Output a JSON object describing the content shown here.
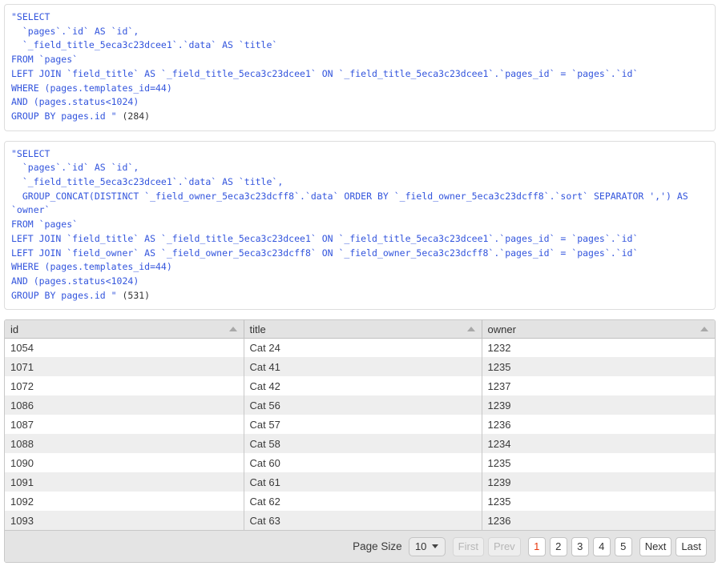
{
  "sql_blocks": [
    {
      "name": "query-one",
      "lines": [
        "\"SELECT",
        "  `pages`.`id` AS `id`,",
        "  `_field_title_5eca3c23dcee1`.`data` AS `title`",
        "FROM `pages`",
        "LEFT JOIN `field_title` AS `_field_title_5eca3c23dcee1` ON `_field_title_5eca3c23dcee1`.`pages_id` = `pages`.`id`",
        "WHERE (pages.templates_id=44)",
        "AND (pages.status<1024)",
        "GROUP BY pages.id \" "
      ],
      "count": "(284)"
    },
    {
      "name": "query-two",
      "lines": [
        "\"SELECT",
        "  `pages`.`id` AS `id`,",
        "  `_field_title_5eca3c23dcee1`.`data` AS `title`,",
        "  GROUP_CONCAT(DISTINCT `_field_owner_5eca3c23dcff8`.`data` ORDER BY `_field_owner_5eca3c23dcff8`.`sort` SEPARATOR ',') AS",
        "`owner`",
        "FROM `pages`",
        "LEFT JOIN `field_title` AS `_field_title_5eca3c23dcee1` ON `_field_title_5eca3c23dcee1`.`pages_id` = `pages`.`id`",
        "LEFT JOIN `field_owner` AS `_field_owner_5eca3c23dcff8` ON `_field_owner_5eca3c23dcff8`.`pages_id` = `pages`.`id`",
        "WHERE (pages.templates_id=44)",
        "AND (pages.status<1024)",
        "GROUP BY pages.id \" "
      ],
      "count": "(531)"
    }
  ],
  "grid": {
    "columns": [
      {
        "key": "id",
        "label": "id",
        "sort": "asc"
      },
      {
        "key": "title",
        "label": "title",
        "sort": "asc"
      },
      {
        "key": "owner",
        "label": "owner",
        "sort": "asc"
      }
    ],
    "rows": [
      {
        "id": "1054",
        "title": "Cat 24",
        "owner": "1232"
      },
      {
        "id": "1071",
        "title": "Cat 41",
        "owner": "1235"
      },
      {
        "id": "1072",
        "title": "Cat 42",
        "owner": "1237"
      },
      {
        "id": "1086",
        "title": "Cat 56",
        "owner": "1239"
      },
      {
        "id": "1087",
        "title": "Cat 57",
        "owner": "1236"
      },
      {
        "id": "1088",
        "title": "Cat 58",
        "owner": "1234"
      },
      {
        "id": "1090",
        "title": "Cat 60",
        "owner": "1235"
      },
      {
        "id": "1091",
        "title": "Cat 61",
        "owner": "1239"
      },
      {
        "id": "1092",
        "title": "Cat 62",
        "owner": "1235"
      },
      {
        "id": "1093",
        "title": "Cat 63",
        "owner": "1236"
      }
    ]
  },
  "pager": {
    "page_size_label": "Page Size",
    "page_size_value": "10",
    "first_label": "First",
    "prev_label": "Prev",
    "next_label": "Next",
    "last_label": "Last",
    "pages": [
      "1",
      "2",
      "3",
      "4",
      "5"
    ],
    "active_page": "1",
    "first_disabled": true,
    "prev_disabled": true
  },
  "colors": {
    "sql_text": "#3355dd",
    "active_page": "#e8380d",
    "header_bg": "#e3e3e3",
    "footer_bg": "#e4e4e4",
    "row_alt_bg": "#eeeeee"
  }
}
